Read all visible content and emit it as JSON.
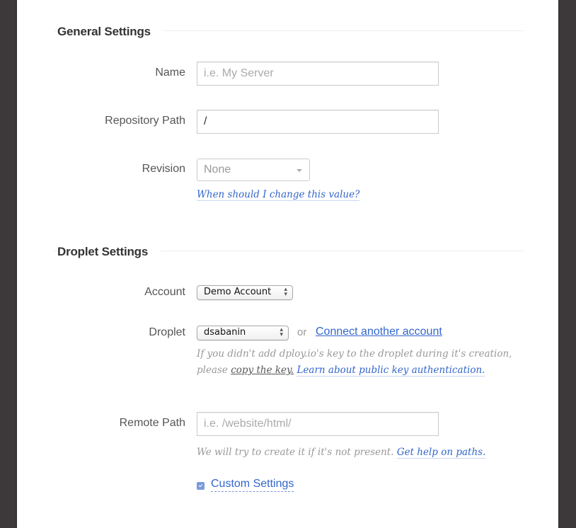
{
  "general": {
    "title": "General Settings",
    "name": {
      "label": "Name",
      "value": "",
      "placeholder": "i.e. My Server"
    },
    "repository_path": {
      "label": "Repository Path",
      "value": "/"
    },
    "revision": {
      "label": "Revision",
      "selected": "None",
      "help_link": "When should I change this value?"
    }
  },
  "droplet": {
    "title": "Droplet Settings",
    "account": {
      "label": "Account",
      "selected": "Demo Account"
    },
    "droplet": {
      "label": "Droplet",
      "selected": "dsabanin",
      "or_text": "or",
      "connect_link": "Connect another account",
      "help_line1": "If you didn't add dploy.io's key to the droplet during it's creation,",
      "help_prefix": "please ",
      "copy_key_link": "copy the key.",
      "learn_link": "Learn about public key authentication."
    },
    "remote_path": {
      "label": "Remote Path",
      "value": "",
      "placeholder": "i.e. /website/html/",
      "help_text": "We will try to create it if it's not present. ",
      "help_link": "Get help on paths."
    },
    "custom_settings": {
      "label": "Custom Settings",
      "expanded": false
    }
  },
  "colors": {
    "link": "#3366cc",
    "background": "#3d393b",
    "panel": "#ffffff"
  }
}
